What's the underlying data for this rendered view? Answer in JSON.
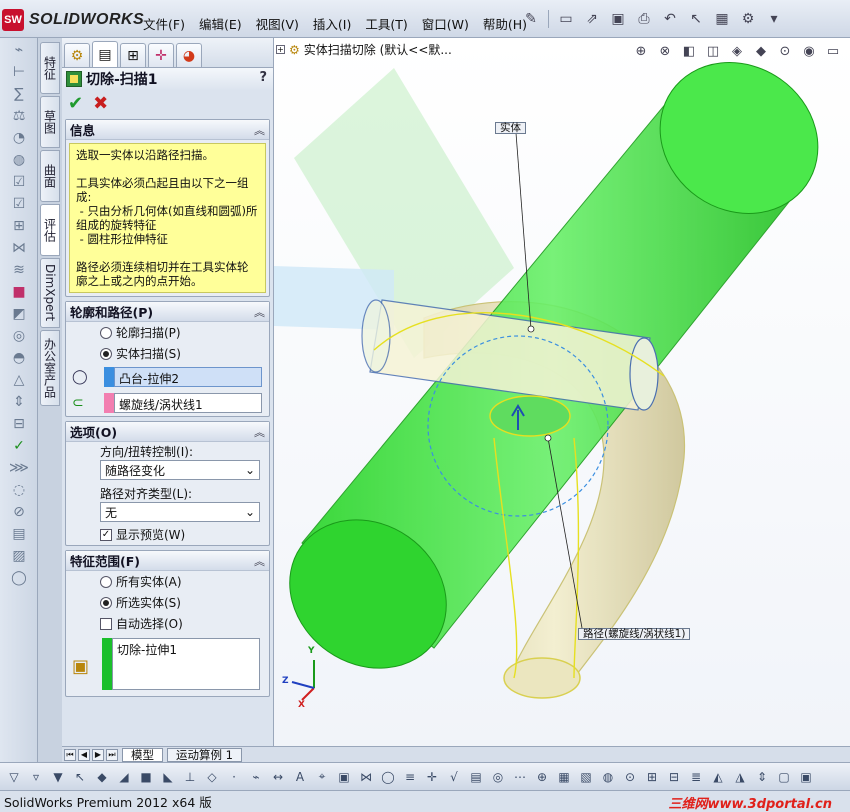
{
  "app": {
    "logo_badge": "SW",
    "logo_text": "SOLIDWORKS",
    "status": "SolidWorks Premium 2012 x64 版",
    "watermark": "三维网www.3dportal.cn"
  },
  "menu": [
    "文件(F)",
    "编辑(E)",
    "视图(V)",
    "插入(I)",
    "工具(T)",
    "窗口(W)",
    "帮助(H)"
  ],
  "vertical_tabs": [
    "特征",
    "草图",
    "曲面",
    "评估",
    "DimXpert",
    "办公室产品"
  ],
  "property_manager": {
    "title": "切除-扫描1",
    "help": "?",
    "info": {
      "title": "信息",
      "text": "选取一实体以沿路径扫描。\n\n工具实体必须凸起且由以下之一组成:\n - 只由分析几何体(如直线和圆弧)所组成的旋转特征\n - 圆柱形拉伸特征\n\n路径必须连续相切并在工具实体轮廓之上或之内的点开始。"
    },
    "profile_path": {
      "title": "轮廓和路径(P)",
      "option_profile": "轮廓扫描(P)",
      "option_solid": "实体扫描(S)",
      "tool_body": "凸台-拉伸2",
      "path": "螺旋线/涡状线1"
    },
    "options": {
      "title": "选项(O)",
      "orientation_label": "方向/扭转控制(I):",
      "orientation_value": "随路径变化",
      "align_label": "路径对齐类型(L):",
      "align_value": "无",
      "show_preview": "显示预览(W)"
    },
    "feature_scope": {
      "title": "特征范围(F)",
      "all_bodies": "所有实体(A)",
      "selected_bodies": "所选实体(S)",
      "auto_select": "自动选择(O)",
      "body": "切除-拉伸1"
    }
  },
  "viewport": {
    "breadcrumb": "实体扫描切除 (默认<<默...",
    "callout_body": "实体",
    "callout_path": "路径(螺旋线/涡状线1)",
    "triad_x": "X",
    "triad_y": "Y",
    "triad_z": "Z"
  },
  "bottom_tabs": [
    "模型",
    "运动算例 1"
  ],
  "colors": {
    "green_body": "#33e033",
    "tool_body": "#efe9b8",
    "path_blue": "#3b8fe0",
    "info_bg": "#ffff99"
  }
}
